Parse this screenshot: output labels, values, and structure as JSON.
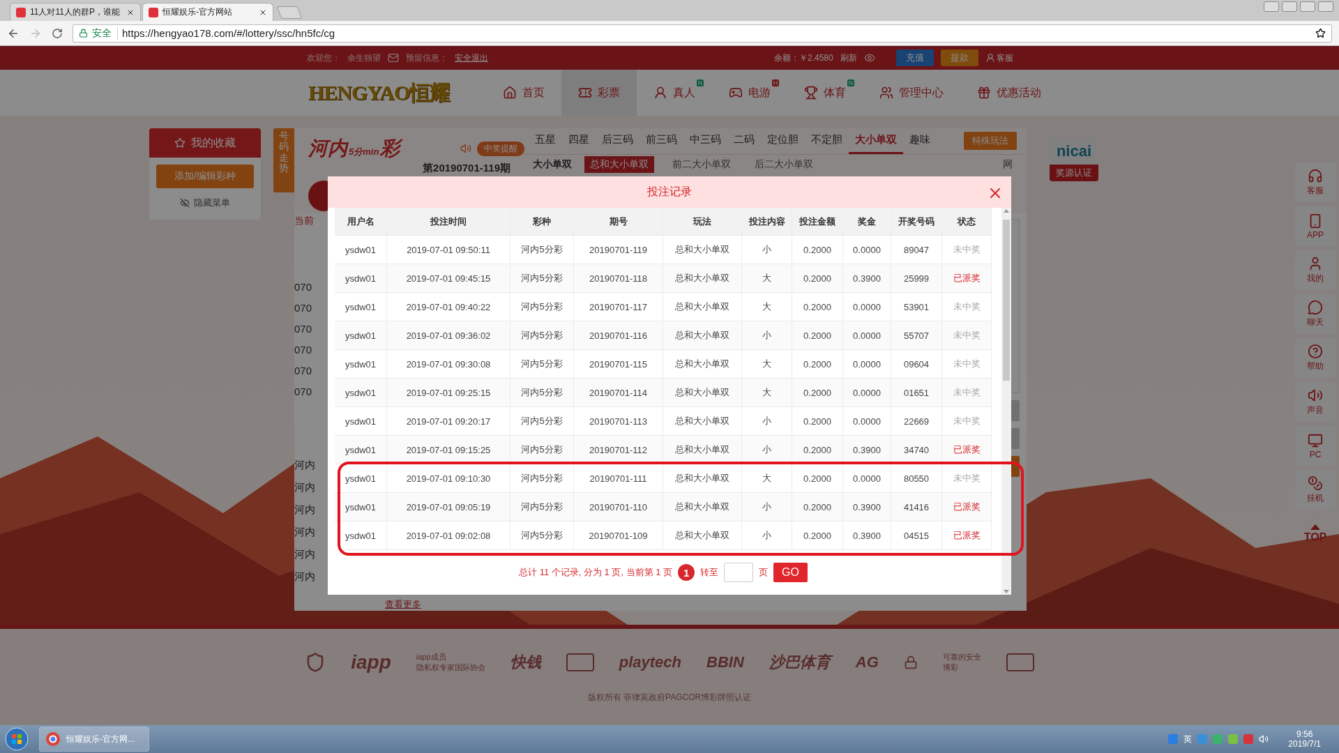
{
  "browser": {
    "tabs": [
      {
        "title": "11人对11人的群P，谁能",
        "selected": false
      },
      {
        "title": "恒耀娱乐-官方网站",
        "selected": true
      }
    ],
    "secure_label": "安全",
    "url": "https://hengyao178.com/#/lottery/ssc/hn5fc/cg"
  },
  "top_bar": {
    "welcome": "欢迎您：",
    "username": "余生独望",
    "reserved_label": "预留信息：",
    "logout": "安全退出",
    "balance": "余额：￥2.4580",
    "refresh": "刷新",
    "deposit": "充值",
    "withdraw": "提款",
    "support": "客服"
  },
  "nav": {
    "logo": "HENGYAO恒耀",
    "items": [
      {
        "label": "首页",
        "selected": false
      },
      {
        "label": "彩票",
        "selected": true
      },
      {
        "label": "真人",
        "selected": false,
        "badge": "N"
      },
      {
        "label": "电游",
        "selected": false,
        "badge": "H"
      },
      {
        "label": "体育",
        "selected": false,
        "badge": "N"
      },
      {
        "label": "管理中心",
        "selected": false
      },
      {
        "label": "优惠活动",
        "selected": false
      }
    ]
  },
  "sidebar": {
    "title": "我的收藏",
    "edit_button": "添加/编辑彩种",
    "hide_menu": "隐藏菜单",
    "trend_tab": "号码走势"
  },
  "game": {
    "logo_main": "河内",
    "logo_sub": "5分min",
    "logo_end": "彩",
    "win_alert": "中奖提醒",
    "issue": "第20190701-119期",
    "tabs": [
      {
        "label": "五星",
        "selected": false
      },
      {
        "label": "四星",
        "selected": false
      },
      {
        "label": "后三码",
        "selected": false
      },
      {
        "label": "前三码",
        "selected": false
      },
      {
        "label": "中三码",
        "selected": false
      },
      {
        "label": "二码",
        "selected": false
      },
      {
        "label": "定位胆",
        "selected": false
      },
      {
        "label": "不定胆",
        "selected": false
      },
      {
        "label": "大小单双",
        "selected": true
      },
      {
        "label": "趣味",
        "selected": false
      }
    ],
    "special_button": "特殊玩法",
    "subtab_group": "大小单双",
    "subtabs": [
      {
        "label": "总和大小单双",
        "selected": true
      },
      {
        "label": "前二大小单双",
        "selected": false
      },
      {
        "label": "后二大小单双",
        "selected": false
      }
    ],
    "right_fragment": "网",
    "current_label": "当前",
    "issue_fragments": [
      "070",
      "070",
      "070",
      "070",
      "070",
      "070"
    ],
    "name_fragments": [
      "河内",
      "河内",
      "河内",
      "河内",
      "河内",
      "河内"
    ],
    "more_link": "查看更多"
  },
  "badge": {
    "logo": "nicai",
    "label": "奖源认证"
  },
  "float_menu": [
    {
      "label": "客服",
      "kind": "service"
    },
    {
      "label": "APP",
      "kind": "app"
    },
    {
      "label": "我的",
      "kind": "mine"
    },
    {
      "label": "聊天",
      "kind": "chat"
    },
    {
      "label": "帮助",
      "kind": "help"
    },
    {
      "label": "声音",
      "kind": "sound"
    },
    {
      "label": "PC",
      "kind": "pc"
    },
    {
      "label": "挂机",
      "kind": "bag"
    },
    {
      "label": "TOP",
      "kind": "top"
    }
  ],
  "modal": {
    "title": "投注记录",
    "columns": [
      "用户名",
      "投注时间",
      "彩种",
      "期号",
      "玩法",
      "投注内容",
      "投注金额",
      "奖金",
      "开奖号码",
      "状态"
    ],
    "rows": [
      {
        "cells": [
          "ysdw01",
          "2019-07-01 09:50:11",
          "河内5分彩",
          "20190701-119",
          "总和大小单双",
          "小",
          "0.2000",
          "0.0000",
          "89047",
          "未中奖"
        ],
        "paid": false,
        "highlighted": false
      },
      {
        "cells": [
          "ysdw01",
          "2019-07-01 09:45:15",
          "河内5分彩",
          "20190701-118",
          "总和大小单双",
          "大",
          "0.2000",
          "0.3900",
          "25999",
          "已派奖"
        ],
        "paid": true,
        "highlighted": false
      },
      {
        "cells": [
          "ysdw01",
          "2019-07-01 09:40:22",
          "河内5分彩",
          "20190701-117",
          "总和大小单双",
          "大",
          "0.2000",
          "0.0000",
          "53901",
          "未中奖"
        ],
        "paid": false,
        "highlighted": false
      },
      {
        "cells": [
          "ysdw01",
          "2019-07-01 09:36:02",
          "河内5分彩",
          "20190701-116",
          "总和大小单双",
          "小",
          "0.2000",
          "0.0000",
          "55707",
          "未中奖"
        ],
        "paid": false,
        "highlighted": false
      },
      {
        "cells": [
          "ysdw01",
          "2019-07-01 09:30:08",
          "河内5分彩",
          "20190701-115",
          "总和大小单双",
          "大",
          "0.2000",
          "0.0000",
          "09604",
          "未中奖"
        ],
        "paid": false,
        "highlighted": false
      },
      {
        "cells": [
          "ysdw01",
          "2019-07-01 09:25:15",
          "河内5分彩",
          "20190701-114",
          "总和大小单双",
          "大",
          "0.2000",
          "0.0000",
          "01651",
          "未中奖"
        ],
        "paid": false,
        "highlighted": false
      },
      {
        "cells": [
          "ysdw01",
          "2019-07-01 09:20:17",
          "河内5分彩",
          "20190701-113",
          "总和大小单双",
          "小",
          "0.2000",
          "0.0000",
          "22669",
          "未中奖"
        ],
        "paid": false,
        "highlighted": false
      },
      {
        "cells": [
          "ysdw01",
          "2019-07-01 09:15:25",
          "河内5分彩",
          "20190701-112",
          "总和大小单双",
          "小",
          "0.2000",
          "0.3900",
          "34740",
          "已派奖"
        ],
        "paid": true,
        "highlighted": false
      },
      {
        "cells": [
          "ysdw01",
          "2019-07-01 09:10:30",
          "河内5分彩",
          "20190701-111",
          "总和大小单双",
          "大",
          "0.2000",
          "0.0000",
          "80550",
          "未中奖"
        ],
        "paid": false,
        "highlighted": true
      },
      {
        "cells": [
          "ysdw01",
          "2019-07-01 09:05:19",
          "河内5分彩",
          "20190701-110",
          "总和大小单双",
          "小",
          "0.2000",
          "0.3900",
          "41416",
          "已派奖"
        ],
        "paid": true,
        "highlighted": true
      },
      {
        "cells": [
          "ysdw01",
          "2019-07-01 09:02:08",
          "河内5分彩",
          "20190701-109",
          "总和大小单双",
          "小",
          "0.2000",
          "0.3900",
          "04515",
          "已派奖"
        ],
        "paid": true,
        "highlighted": true
      }
    ],
    "summary": "总计 11 个记录, 分为 1 页, 当前第 1 页",
    "pages": [
      {
        "label": "1",
        "selected": true
      }
    ],
    "goto_label": "转至",
    "page_unit": "页",
    "go_button": "GO"
  },
  "footer": {
    "logos": [
      {
        "kind": "crest"
      },
      {
        "kind": "iapp",
        "text": "iapp",
        "lines": [
          "iapp成员",
          "隐私权专家国际协会"
        ]
      },
      {
        "kind": "word",
        "text": "快钱"
      },
      {
        "kind": "card"
      },
      {
        "kind": "word",
        "text": "playtech"
      },
      {
        "kind": "word",
        "text": "BBIN"
      },
      {
        "kind": "word",
        "text": "沙巴体育"
      },
      {
        "kind": "word",
        "text": "AG"
      },
      {
        "kind": "lock",
        "lines": [
          "可靠的安全",
          "博彩"
        ]
      },
      {
        "kind": "card"
      }
    ],
    "copyright": "版权所有 菲律宾政府PAGCOR博彩牌照认证"
  },
  "taskbar": {
    "task": "恒耀娱乐-官方网...",
    "ime": "英",
    "time": "9:56",
    "date": "2019/7/1"
  }
}
